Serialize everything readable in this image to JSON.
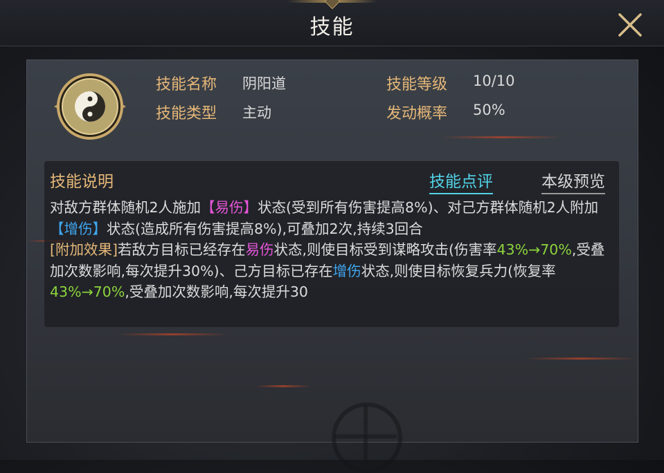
{
  "header": {
    "title": "技能"
  },
  "skill": {
    "icon": "yin-yang-icon",
    "name_label": "技能名称",
    "name": "阴阳道",
    "type_label": "技能类型",
    "type": "主动",
    "level_label": "技能等级",
    "level": "10/10",
    "chance_label": "发动概率",
    "chance": "50%"
  },
  "description": {
    "title": "技能说明",
    "review_tab": "技能点评",
    "preview_tab": "本级预览",
    "p1_a": "对敌方群体随机2人施加",
    "p1_tag1": "【易伤】",
    "p1_b": "状态(受到所有伤害提高8%)、对己方群体随机2人附加",
    "p1_tag2": "【增伤】",
    "p1_c": "状态(造成所有伤害提高8%),可叠加2次,持续3回合",
    "p2_lead": "[附加效果]",
    "p2_a": "若敌方目标已经存在",
    "p2_tag1": "易伤",
    "p2_b": "状态,则使目标受到谋略攻击(伤害率",
    "p2_rate1": "43%→70%",
    "p2_c": ",受叠加次数影响,每次提升30%)、己方目标已存在",
    "p2_tag2": "增伤",
    "p2_d": "状态,则使目标恢复兵力(恢复率",
    "p2_rate2": "43%→70%",
    "p2_e": ",受叠加次数影响,每次提升30"
  },
  "colors": {
    "label": "#e6b878",
    "pink": "#e655d8",
    "blue": "#3fa6ee",
    "green": "#8dd43c",
    "cyan": "#52d3e8"
  }
}
